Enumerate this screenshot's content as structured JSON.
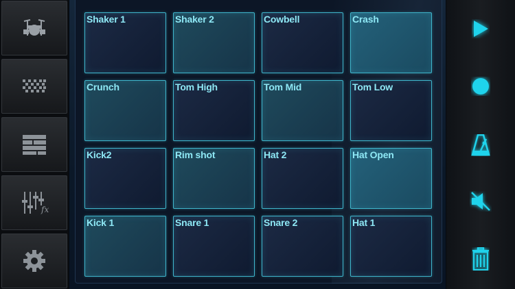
{
  "colors": {
    "accent": "#1fd3ec",
    "pad_border": "#3fb6cc",
    "pad_label": "#8ee8f5"
  },
  "sidebar": {
    "items": [
      {
        "icon": "drum-kit-icon"
      },
      {
        "icon": "step-sequencer-icon"
      },
      {
        "icon": "song-blocks-icon"
      },
      {
        "icon": "mixer-fx-icon",
        "label": "fx"
      },
      {
        "icon": "gear-icon"
      }
    ]
  },
  "pads": [
    {
      "label": "Shaker 1"
    },
    {
      "label": "Shaker 2"
    },
    {
      "label": "Cowbell"
    },
    {
      "label": "Crash"
    },
    {
      "label": "Crunch"
    },
    {
      "label": "Tom High"
    },
    {
      "label": "Tom Mid"
    },
    {
      "label": "Tom Low"
    },
    {
      "label": "Kick2"
    },
    {
      "label": "Rim shot"
    },
    {
      "label": "Hat 2"
    },
    {
      "label": "Hat Open"
    },
    {
      "label": "Kick 1"
    },
    {
      "label": "Snare 1"
    },
    {
      "label": "Snare 2"
    },
    {
      "label": "Hat 1"
    }
  ],
  "transport": {
    "items": [
      {
        "icon": "play-icon"
      },
      {
        "icon": "record-icon"
      },
      {
        "icon": "metronome-icon"
      },
      {
        "icon": "mute-icon"
      },
      {
        "icon": "trash-icon"
      }
    ]
  }
}
